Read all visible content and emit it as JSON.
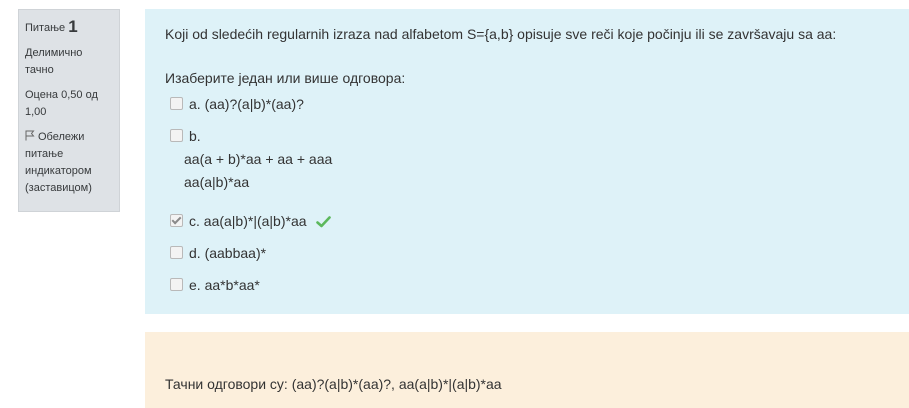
{
  "info": {
    "question_label": "Питање",
    "question_number": "1",
    "state": "Делимично тачно",
    "grade": "Оцена 0,50 од 1,00",
    "flag_label": "Обележи питање индикатором (заставицом)"
  },
  "question": {
    "text": "Koji od sledećih regularnih izraza nad alfabetom S={a,b} opisuje sve reči koje počinju ili se završavaju sa aa:",
    "prompt": "Изаберите један или више одговора:",
    "answers": [
      {
        "label": "a. (aa)?(a|b)*(aa)?",
        "checked": false
      },
      {
        "label": "b.",
        "lines": [
          "aa(a + b)*aa + aa + aaa",
          "aa(a|b)*aa"
        ],
        "checked": false
      },
      {
        "label": "c. aa(a|b)*|(a|b)*aa",
        "checked": true,
        "correct": true
      },
      {
        "label": "d. (aabbaa)*",
        "checked": false
      },
      {
        "label": "e. aa*b*aa*",
        "checked": false
      }
    ]
  },
  "feedback": {
    "right_answer": "Тачни одговори су: (aa)?(a|b)*(aa)?, aa(a|b)*|(a|b)*aa"
  },
  "colors": {
    "formulation_bg": "#def2f8",
    "feedback_bg": "#fcefdc",
    "info_bg": "#dee2e6",
    "correct_tick": "#5cb85c"
  }
}
